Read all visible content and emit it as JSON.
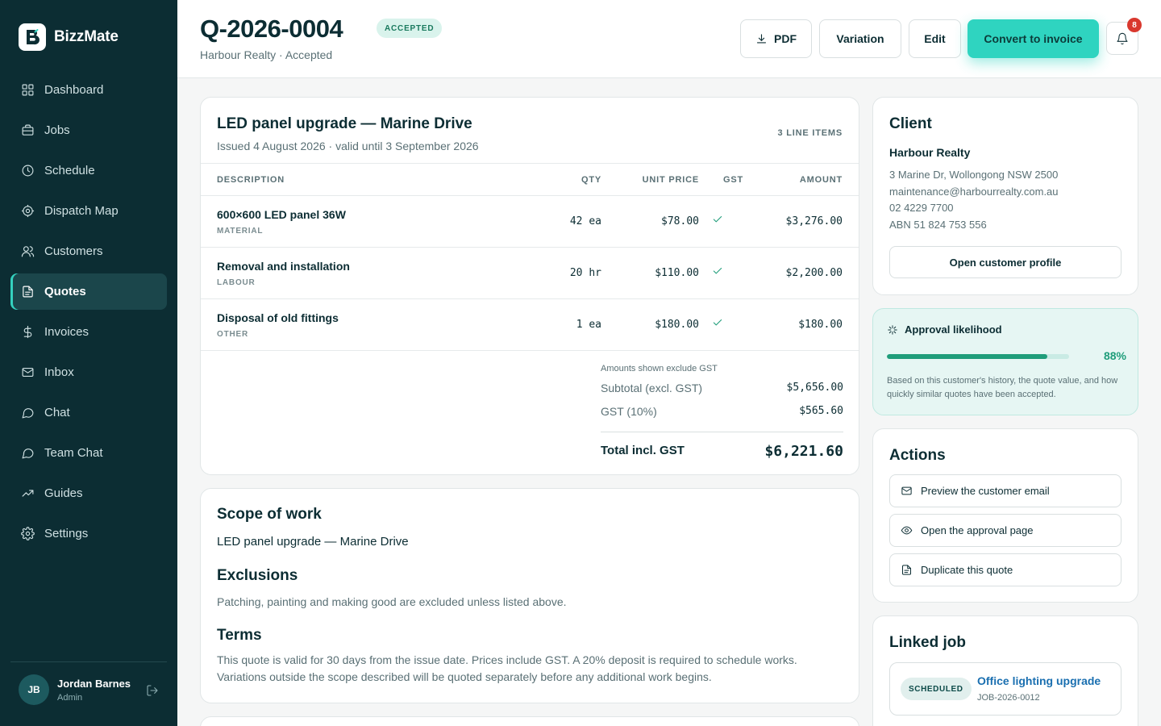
{
  "app": {
    "name": "BizzMate"
  },
  "sidebar": {
    "items": [
      {
        "label": "Dashboard",
        "icon": "grid-icon"
      },
      {
        "label": "Jobs",
        "icon": "briefcase-icon"
      },
      {
        "label": "Schedule",
        "icon": "clock-icon"
      },
      {
        "label": "Dispatch Map",
        "icon": "target-icon"
      },
      {
        "label": "Customers",
        "icon": "users-icon"
      },
      {
        "label": "Quotes",
        "icon": "file-icon",
        "active": true
      },
      {
        "label": "Invoices",
        "icon": "dollar-icon"
      },
      {
        "label": "Inbox",
        "icon": "mail-icon"
      },
      {
        "label": "Chat",
        "icon": "chat-icon"
      },
      {
        "label": "Team Chat",
        "icon": "chat-icon"
      },
      {
        "label": "Guides",
        "icon": "trend-icon"
      },
      {
        "label": "Settings",
        "icon": "gear-icon"
      }
    ],
    "user": {
      "initials": "JB",
      "name": "Jordan Barnes",
      "role": "Admin"
    }
  },
  "header": {
    "title": "Q-2026-0004",
    "status_badge": "ACCEPTED",
    "subtitle": "Harbour Realty · Accepted",
    "buttons": {
      "pdf": "PDF",
      "variation": "Variation",
      "edit": "Edit",
      "convert": "Convert to invoice"
    },
    "notifications": "8"
  },
  "quote": {
    "title": "LED panel upgrade — Marine Drive",
    "issued": "Issued 4 August 2026 · valid until 3 September 2026",
    "count": "3 LINE ITEMS",
    "columns": {
      "description": "DESCRIPTION",
      "qty": "QTY",
      "unit_price": "UNIT PRICE",
      "gst": "GST",
      "amount": "AMOUNT"
    },
    "items": [
      {
        "description": "600×600 LED panel 36W",
        "category": "MATERIAL",
        "qty": "42 ea",
        "unit_price": "$78.00",
        "amount": "$3,276.00"
      },
      {
        "description": "Removal and installation",
        "category": "LABOUR",
        "qty": "20 hr",
        "unit_price": "$110.00",
        "amount": "$2,200.00"
      },
      {
        "description": "Disposal of old fittings",
        "category": "OTHER",
        "qty": "1 ea",
        "unit_price": "$180.00",
        "amount": "$180.00"
      }
    ],
    "totals": {
      "note": "Amounts shown exclude GST",
      "subtotal_label": "Subtotal (excl. GST)",
      "subtotal": "$5,656.00",
      "gst_label": "GST (10%)",
      "gst": "$565.60",
      "total_label": "Total incl. GST",
      "total": "$6,221.60"
    }
  },
  "scope": {
    "title": "Scope of work",
    "text": "LED panel upgrade — Marine Drive",
    "exclusions_title": "Exclusions",
    "exclusions": "Patching, painting and making good are excluded unless listed above.",
    "terms_title": "Terms",
    "terms": "This quote is valid for 30 days from the issue date. Prices include GST. A 20% deposit is required to schedule works. Variations outside the scope described will be quoted separately before any additional work begins."
  },
  "client": {
    "title": "Client",
    "name": "Harbour Realty",
    "address": "3 Marine Dr, Wollongong NSW 2500",
    "email": "maintenance@harbourrealty.com.au",
    "phone": "02 4229 7700",
    "abn": "ABN 51 824 753 556",
    "button": "Open customer profile"
  },
  "approval": {
    "title": "Approval likelihood",
    "percent": 88,
    "percent_label": "88%",
    "note": "Based on this customer's history, the quote value, and how quickly similar quotes have been accepted."
  },
  "actions": {
    "title": "Actions",
    "preview_email": "Preview the customer email",
    "approval_page": "Open the approval page",
    "duplicate": "Duplicate this quote"
  },
  "linked_job": {
    "title": "Linked job",
    "status": "SCHEDULED",
    "name": "Office lighting upgrade",
    "id": "JOB-2026-0012"
  },
  "colors": {
    "sidebar": "#0c2d33",
    "accent": "#2fd4c0",
    "success": "#1f9d7a",
    "danger": "#d9382e"
  }
}
